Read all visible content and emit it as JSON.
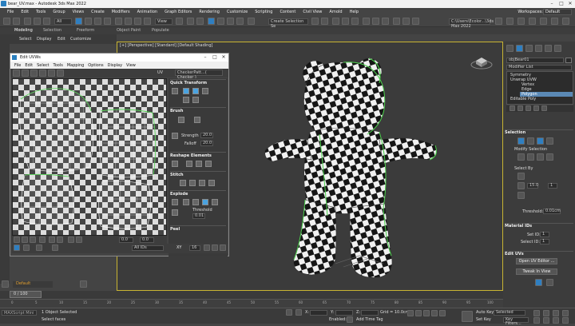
{
  "app": {
    "title": "bear_UV.max - Autodesk 3ds Max 2022"
  },
  "menu": [
    "File",
    "Edit",
    "Tools",
    "Group",
    "Views",
    "Create",
    "Modifiers",
    "Animation",
    "Graph Editors",
    "Rendering",
    "Customize",
    "Scripting",
    "Content",
    "Civil View",
    "Arnold",
    "Help"
  ],
  "workspace": {
    "label": "Workspaces:",
    "value": "Default"
  },
  "toolbar": {
    "selection_set": "Create Selection Se",
    "path": "C:\\Users\\Ecolor...\\3ds Max 2022",
    "all": "All",
    "view": "View"
  },
  "toolbar2": {
    "items": [
      "Modeling",
      "Selection",
      "Freeform",
      "Object Paint",
      "Populate"
    ]
  },
  "ribbon": {
    "items": [
      "Select",
      "Display",
      "Edit",
      "Customize"
    ]
  },
  "viewport": {
    "label": "[+] [Perspective] [Standard] [Default Shading]"
  },
  "uvw": {
    "title": "Edit UVWs",
    "menu": [
      "File",
      "Edit",
      "Select",
      "Tools",
      "Mapping",
      "Options",
      "Display",
      "View"
    ],
    "uv_label": "UV",
    "map": "CheckerPatt...( Checker )",
    "sections": {
      "quick": "Quick Transform",
      "brush": "Brush",
      "reshape": "Reshape Elements",
      "stitch": "Stitch",
      "explode": "Explode",
      "peel": "Peel"
    },
    "strength_label": "Strength",
    "strength": "20.0",
    "falloff_label": "Falloff",
    "falloff": "20.0",
    "threshold_label": "Threshold",
    "threshold": "0.01",
    "bottom": {
      "value1": "0.0",
      "value2": "0.0",
      "xy": "XY",
      "value3": "16",
      "ids": "All IDs"
    }
  },
  "cmd": {
    "object": "objBear01",
    "modlist": "Modifier List",
    "stack": [
      "Symmetry",
      "Unwrap UVW",
      "Vertex",
      "Edge",
      "Polygon",
      "Editable Poly"
    ],
    "selected_stack": "Polygon",
    "selection_hdr": "Selection",
    "modify_sel": "Modify Selection",
    "select_by": "Select By",
    "sel_val": "15.0",
    "sel_num": "1",
    "threshold_label": "Threshold:",
    "threshold": "0.01cm",
    "matid_hdr": "Material IDs",
    "set_id": "Set ID:",
    "set_id_val": "1",
    "select_id": "Select ID:",
    "select_id_val": "1",
    "edituv_hdr": "Edit UVs",
    "open_uv": "Open UV Editor ...",
    "tweak": "Tweak In View"
  },
  "timeline": {
    "frame": "0 / 100",
    "ticks": [
      "0",
      "5",
      "10",
      "15",
      "20",
      "25",
      "30",
      "35",
      "40",
      "45",
      "50",
      "55",
      "60",
      "65",
      "70",
      "75",
      "80",
      "85",
      "90",
      "95",
      "100"
    ],
    "layer": "Default"
  },
  "status": {
    "objects": "1 Object Selected",
    "prompt": "Select faces",
    "script": "MAXScript Mini",
    "x": "X:",
    "y": "Y:",
    "z": "Z:",
    "grid": "Grid = 10.0cm",
    "enabled": "Enabled:",
    "addtime": "Add Time Tag",
    "autokey": "Auto Key",
    "setkey": "Set Key",
    "selected": "Selected",
    "keyfilters": "Key Filters..."
  }
}
